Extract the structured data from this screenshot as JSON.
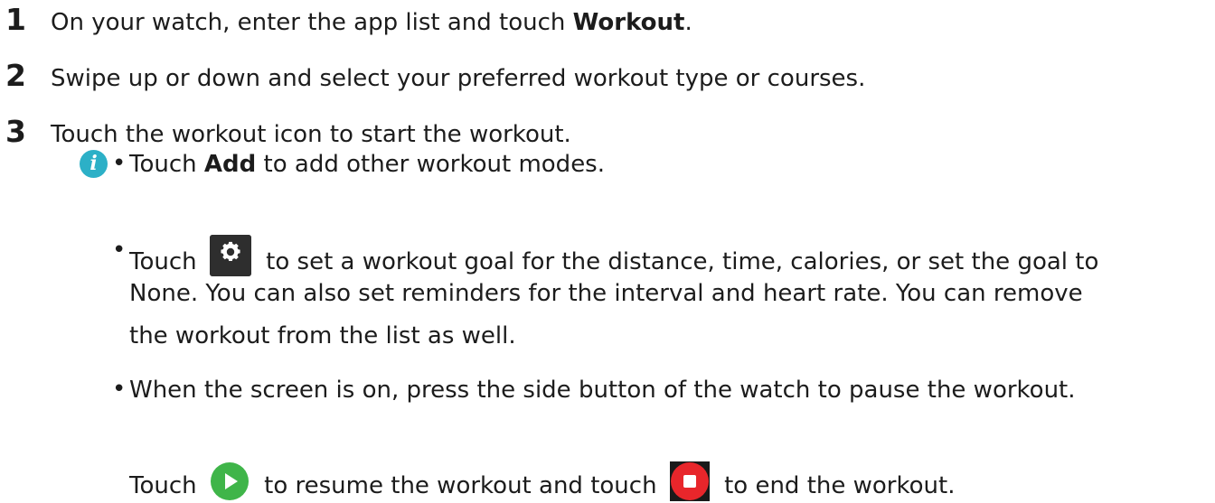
{
  "steps": [
    {
      "num": "1",
      "text_before": "On your watch, enter the app list and touch ",
      "bold": "Workout",
      "text_after": "."
    },
    {
      "num": "2",
      "text": "Swipe up or down and select your preferred workout type or courses."
    },
    {
      "num": "3",
      "text": "Touch the workout icon to start the workout."
    }
  ],
  "notes": {
    "info_icon_glyph": "i",
    "bullet_glyph": "•",
    "item1": {
      "before": "Touch ",
      "bold": "Add",
      "after": " to add other workout modes."
    },
    "item2": {
      "before": "Touch ",
      "after": " to set a workout goal for the distance, time, calories, or set the goal to",
      "line2": "None. You can also set reminders for the interval and heart rate. You can remove",
      "line3": "the workout from the list as well."
    },
    "item3": {
      "line1": "When the screen is on, press the side button of the watch to pause the workout.",
      "line2_before": "Touch ",
      "line2_middle": " to resume the workout and touch ",
      "line2_after": " to end the workout."
    }
  },
  "icons": {
    "settings": "gear-icon",
    "resume": "play-icon",
    "end": "stop-icon"
  },
  "colors": {
    "info_icon": "#2cb0c7",
    "play_icon": "#3fb549",
    "stop_icon": "#e8262b",
    "settings_bg": "#2e2e2e"
  }
}
